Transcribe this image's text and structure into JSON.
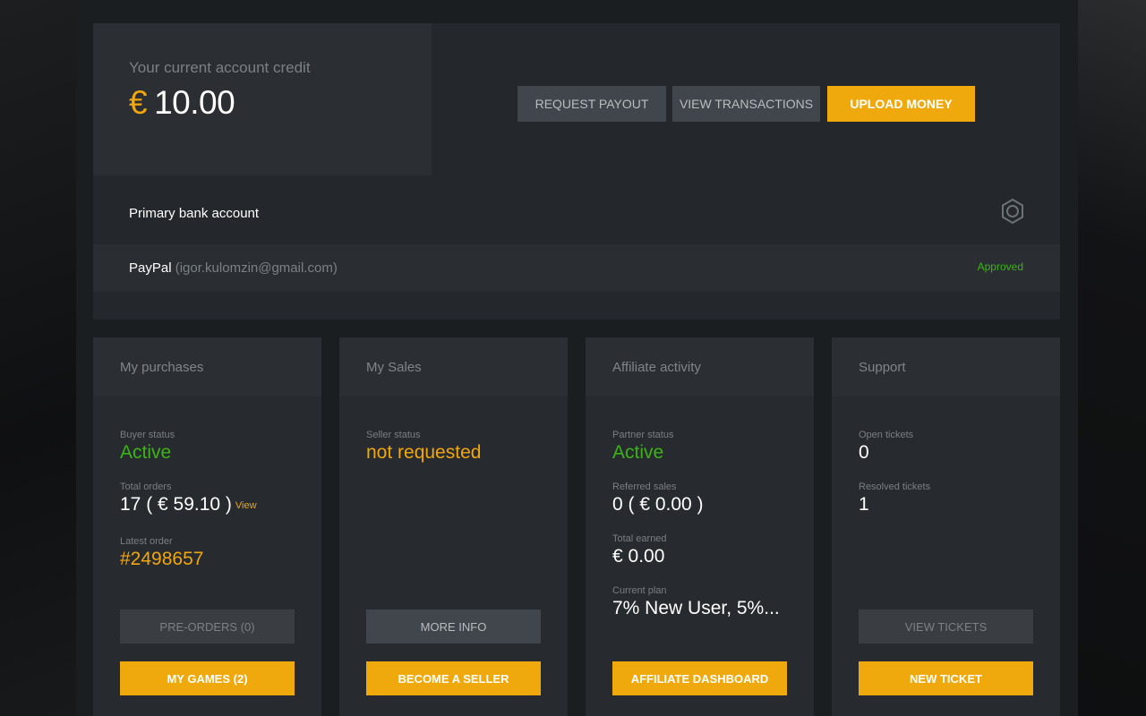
{
  "account": {
    "credit_label": "Your current account credit",
    "currency_symbol": "€",
    "credit_amount": "10.00",
    "buttons": {
      "request_payout": "REQUEST PAYOUT",
      "view_transactions": "VIEW TRANSACTIONS",
      "upload_money": "UPLOAD MONEY"
    },
    "bank_title": "Primary bank account",
    "bank_method": "PayPal",
    "bank_email": "(igor.kulomzin@gmail.com)",
    "bank_status": "Approved"
  },
  "cards": {
    "purchases": {
      "title": "My purchases",
      "buyer_status_label": "Buyer status",
      "buyer_status": "Active",
      "total_orders_label": "Total orders",
      "total_orders": "17 ( € 59.10 )",
      "view_link": "View",
      "latest_order_label": "Latest order",
      "latest_order": "#2498657",
      "preorders_button": "PRE-ORDERS (0)",
      "mygames_button": "MY GAMES (2)"
    },
    "sales": {
      "title": "My Sales",
      "seller_status_label": "Seller status",
      "seller_status": "not requested",
      "more_info_button": "MORE INFO",
      "become_seller_button": "BECOME A SELLER"
    },
    "affiliate": {
      "title": "Affiliate activity",
      "partner_status_label": "Partner status",
      "partner_status": "Active",
      "referred_sales_label": "Referred sales",
      "referred_sales": "0 ( € 0.00 )",
      "total_earned_label": "Total earned",
      "total_earned": "€ 0.00",
      "current_plan_label": "Current plan",
      "current_plan": "7% New User, 5%...",
      "dashboard_button": "AFFILIATE DASHBOARD"
    },
    "support": {
      "title": "Support",
      "open_tickets_label": "Open tickets",
      "open_tickets": "0",
      "resolved_tickets_label": "Resolved tickets",
      "resolved_tickets": "1",
      "view_tickets_button": "VIEW TICKETS",
      "new_ticket_button": "NEW TICKET"
    }
  },
  "colors": {
    "accent": "#f0a90d",
    "success": "#3bb317",
    "panel": "#24282c"
  },
  "icons": {
    "settings": "gear-icon"
  }
}
